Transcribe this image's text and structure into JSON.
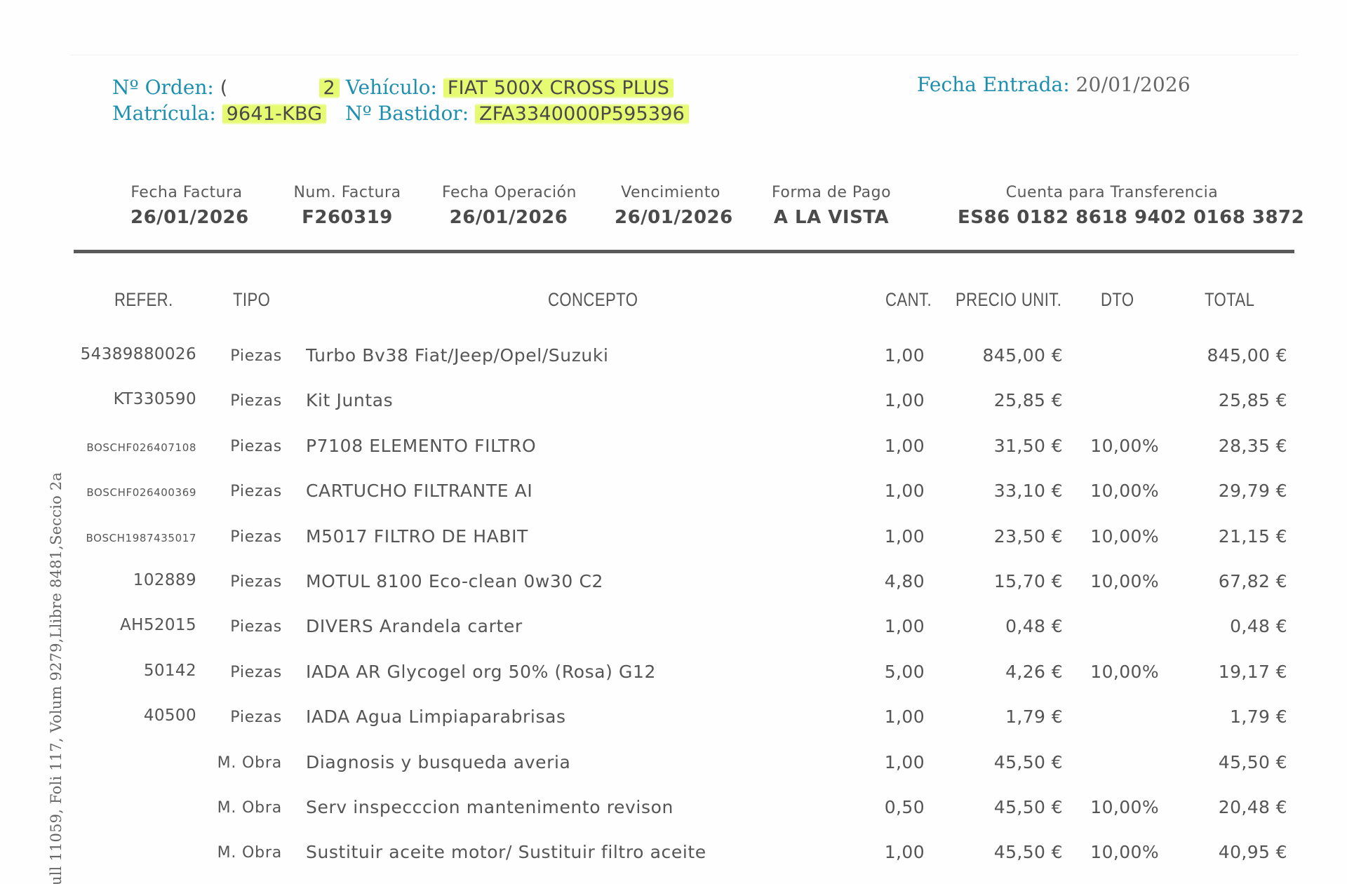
{
  "header": {
    "order_label": "Nº Orden:",
    "order_prefix": "(",
    "order_suffix": "2",
    "vehicle_label": "Vehículo:",
    "vehicle_value": "FIAT 500X CROSS PLUS",
    "plate_label": "Matrícula:",
    "plate_value": "9641-KBG",
    "vin_label": "Nº Bastidor:",
    "vin_value": "ZFA3340000P595396",
    "entry_label": "Fecha Entrada:",
    "entry_value": "20/01/2026"
  },
  "invoice": {
    "date_label": "Fecha Factura",
    "date_value": "26/01/2026",
    "number_label": "Num. Factura",
    "number_value": "F260319",
    "operation_label": "Fecha Operación",
    "operation_value": "26/01/2026",
    "due_label": "Vencimiento",
    "due_value": "26/01/2026",
    "payment_label": "Forma de Pago",
    "payment_value": "A LA VISTA",
    "account_label": "Cuenta para Transferencia",
    "account_value": "ES86 0182 8618 9402 0168 3872"
  },
  "table": {
    "headers": {
      "ref": "REFER.",
      "tipo": "TIPO",
      "concepto": "CONCEPTO",
      "cant": "CANT.",
      "precio": "PRECIO UNIT.",
      "dto": "DTO",
      "total": "TOTAL"
    },
    "rows": [
      {
        "ref": "54389880026",
        "tipo": "Piezas",
        "concepto": "Turbo Bv38 Fiat/Jeep/Opel/Suzuki",
        "cant": "1,00",
        "precio": "845,00 €",
        "dto": "",
        "total": "845,00 €"
      },
      {
        "ref": "KT330590",
        "tipo": "Piezas",
        "concepto": "Kit Juntas",
        "cant": "1,00",
        "precio": "25,85 €",
        "dto": "",
        "total": "25,85 €"
      },
      {
        "ref": "BOSCHF026407108",
        "tipo": "Piezas",
        "concepto": "P7108 ELEMENTO FILTRO",
        "cant": "1,00",
        "precio": "31,50 €",
        "dto": "10,00%",
        "total": "28,35 €"
      },
      {
        "ref": "BOSCHF026400369",
        "tipo": "Piezas",
        "concepto": "CARTUCHO FILTRANTE AI",
        "cant": "1,00",
        "precio": "33,10 €",
        "dto": "10,00%",
        "total": "29,79 €"
      },
      {
        "ref": "BOSCH1987435017",
        "tipo": "Piezas",
        "concepto": "M5017 FILTRO DE HABIT",
        "cant": "1,00",
        "precio": "23,50 €",
        "dto": "10,00%",
        "total": "21,15 €"
      },
      {
        "ref": "102889",
        "tipo": "Piezas",
        "concepto": "MOTUL 8100 Eco-clean 0w30 C2",
        "cant": "4,80",
        "precio": "15,70 €",
        "dto": "10,00%",
        "total": "67,82 €"
      },
      {
        "ref": "AH52015",
        "tipo": "Piezas",
        "concepto": "DIVERS Arandela carter",
        "cant": "1,00",
        "precio": "0,48 €",
        "dto": "",
        "total": "0,48 €"
      },
      {
        "ref": "50142",
        "tipo": "Piezas",
        "concepto": "IADA AR Glycogel org 50% (Rosa) G12",
        "cant": "5,00",
        "precio": "4,26 €",
        "dto": "10,00%",
        "total": "19,17 €"
      },
      {
        "ref": "40500",
        "tipo": "Piezas",
        "concepto": "IADA Agua Limpiaparabrisas",
        "cant": "1,00",
        "precio": "1,79 €",
        "dto": "",
        "total": "1,79 €"
      },
      {
        "ref": "",
        "tipo": "M. Obra",
        "concepto": "Diagnosis y busqueda averia",
        "cant": "1,00",
        "precio": "45,50 €",
        "dto": "",
        "total": "45,50 €"
      },
      {
        "ref": "",
        "tipo": "M. Obra",
        "concepto": "Serv inspecccion mantenimento revison",
        "cant": "0,50",
        "precio": "45,50 €",
        "dto": "10,00%",
        "total": "20,48 €"
      },
      {
        "ref": "",
        "tipo": "M. Obra",
        "concepto": "Sustituir aceite motor/ Sustituir filtro aceite",
        "cant": "1,00",
        "precio": "45,50 €",
        "dto": "10,00%",
        "total": "40,95 €"
      }
    ]
  },
  "side_text": "ull 11059, Foli 117, Volum 9279,Llibre 8481,Seccio 2a",
  "colors": {
    "header_blue": "#1f8fb0",
    "highlight": "#e2fa5a",
    "text_gray": "#555555"
  }
}
